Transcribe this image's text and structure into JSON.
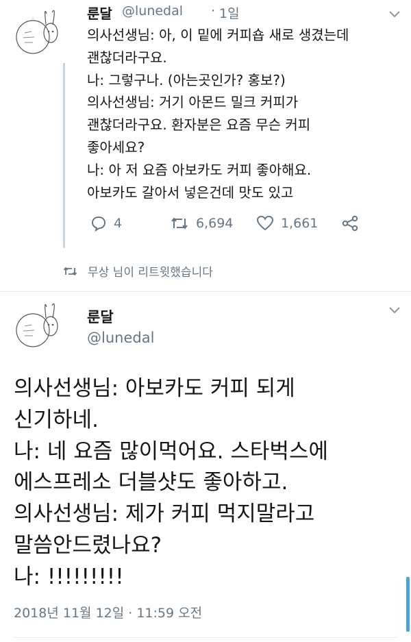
{
  "tweet1": {
    "display_name": "룬달",
    "handle": "@lunedal",
    "separator": "·",
    "time": "1일",
    "body": "의사선생님: 아, 이 밑에 커피숍 새로 생겼는데\n괜찮더라구요.\n나: 그렇구나. (아는곳인가? 홍보?)\n의사선생님: 거기 아몬드 밀크 커피가\n괜찮더라구요. 환자분은 요즘 무슨 커피\n좋아세요?\n나: 아 저 요즘 아보카도 커피 좋아해요.\n아보카도 갈아서 넣은건데 맛도 있고",
    "reply_count": "4",
    "retweet_count": "6,694",
    "like_count": "1,661",
    "retweet_notice": "무상 님이 리트윗했습니다",
    "icons": [
      "reply-icon",
      "retweet-icon",
      "like-icon",
      "share-icon",
      "chevron-down-icon"
    ]
  },
  "tweet2": {
    "display_name": "룬달",
    "handle": "@lunedal",
    "body": "의사선생님: 아보카도 커피 되게\n신기하네.\n나: 네 요즘 많이먹어요. 스타벅스에\n에스프레소 더블샷도 좋아하고.\n의사선생님: 제가 커피 먹지말라고\n말씀안드렸나요?\n나: !!!!!!!!!",
    "date": "2018년 11월 12일 · 11:59 오전"
  },
  "colors": {
    "text": "#14171a",
    "muted": "#657786",
    "divider": "#e6ecf0",
    "accent": "#4aa3df"
  }
}
